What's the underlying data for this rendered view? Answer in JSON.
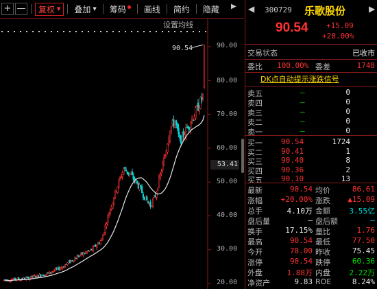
{
  "toolbar": {
    "plus": "+",
    "minus": "—",
    "fq": "复权",
    "overlay": "叠加",
    "chips": "筹码",
    "draw": "画线",
    "brief": "简约",
    "hide": "隐藏",
    "back": "▶"
  },
  "chart": {
    "ma_setting": "设置均线",
    "peak_label": "90.54",
    "price_tag": "53.41",
    "axis_ticks": [
      "90.00",
      "80.00",
      "70.00",
      "60.00",
      "50.00",
      "40.00",
      "30.00",
      "20.00"
    ]
  },
  "chart_data": {
    "type": "candlestick",
    "ylim": [
      19,
      95
    ],
    "axis_ticks": [
      90,
      80,
      70,
      60,
      50,
      40,
      30,
      20
    ],
    "peak": 90.54,
    "up_color": "#ff3232",
    "down_color": "#00d8d8",
    "ma_color": "#e8e8e8"
  },
  "quote": {
    "code": "300729",
    "name": "乐歌股份",
    "price": "90.54",
    "change": "+15.09",
    "change_pct": "+20.00%",
    "status_label": "交易状态",
    "status_value": "已收市",
    "weibi_label": "委比",
    "weibi_value": "100.00%",
    "weicha_label": "委差",
    "weicha_value": "1748",
    "dk_link": "DK点自动提示涨跌信号",
    "asks": [
      {
        "label": "卖五",
        "price": "—",
        "vol": "0"
      },
      {
        "label": "卖四",
        "price": "—",
        "vol": "0"
      },
      {
        "label": "卖三",
        "price": "—",
        "vol": "0"
      },
      {
        "label": "卖二",
        "price": "—",
        "vol": "0"
      },
      {
        "label": "卖一",
        "price": "—",
        "vol": "0"
      }
    ],
    "bids": [
      {
        "label": "买一",
        "price": "90.54",
        "vol": "1724"
      },
      {
        "label": "买二",
        "price": "90.41",
        "vol": "1"
      },
      {
        "label": "买三",
        "price": "90.40",
        "vol": "8"
      },
      {
        "label": "买四",
        "price": "90.36",
        "vol": "2"
      },
      {
        "label": "买五",
        "price": "90.10",
        "vol": "13"
      }
    ],
    "stats": [
      {
        "l1": "最新",
        "v1": "90.54",
        "c1": "red",
        "l2": "均价",
        "v2": "86.61",
        "c2": "red"
      },
      {
        "l1": "涨幅",
        "v1": "+20.00%",
        "c1": "red",
        "l2": "涨跌",
        "v2": "▲15.09",
        "c2": "red"
      },
      {
        "l1": "总手",
        "v1": "4.10万",
        "c1": "white",
        "l2": "金额",
        "v2": "3.55亿",
        "c2": "cyan"
      },
      {
        "l1": "盘后量",
        "v1": "—",
        "c1": "white",
        "l2": "盘后额",
        "v2": "—",
        "c2": "cyan"
      },
      {
        "l1": "换手",
        "v1": "17.15%",
        "c1": "white",
        "l2": "量比",
        "v2": "1.76",
        "c2": "red"
      },
      {
        "l1": "最高",
        "v1": "90.54",
        "c1": "red",
        "l2": "最低",
        "v2": "77.50",
        "c2": "red"
      },
      {
        "l1": "今开",
        "v1": "78.00",
        "c1": "red",
        "l2": "昨收",
        "v2": "75.45",
        "c2": "white"
      },
      {
        "l1": "涨停",
        "v1": "90.54",
        "c1": "red",
        "l2": "跌停",
        "v2": "60.36",
        "c2": "green"
      },
      {
        "l1": "外盘",
        "v1": "1.88万",
        "c1": "red",
        "l2": "内盘",
        "v2": "2.22万",
        "c2": "green"
      },
      {
        "l1": "净资产",
        "v1": "9.83",
        "c1": "white",
        "l2": "ROE",
        "v2": "8.24%",
        "c2": "white"
      }
    ]
  }
}
